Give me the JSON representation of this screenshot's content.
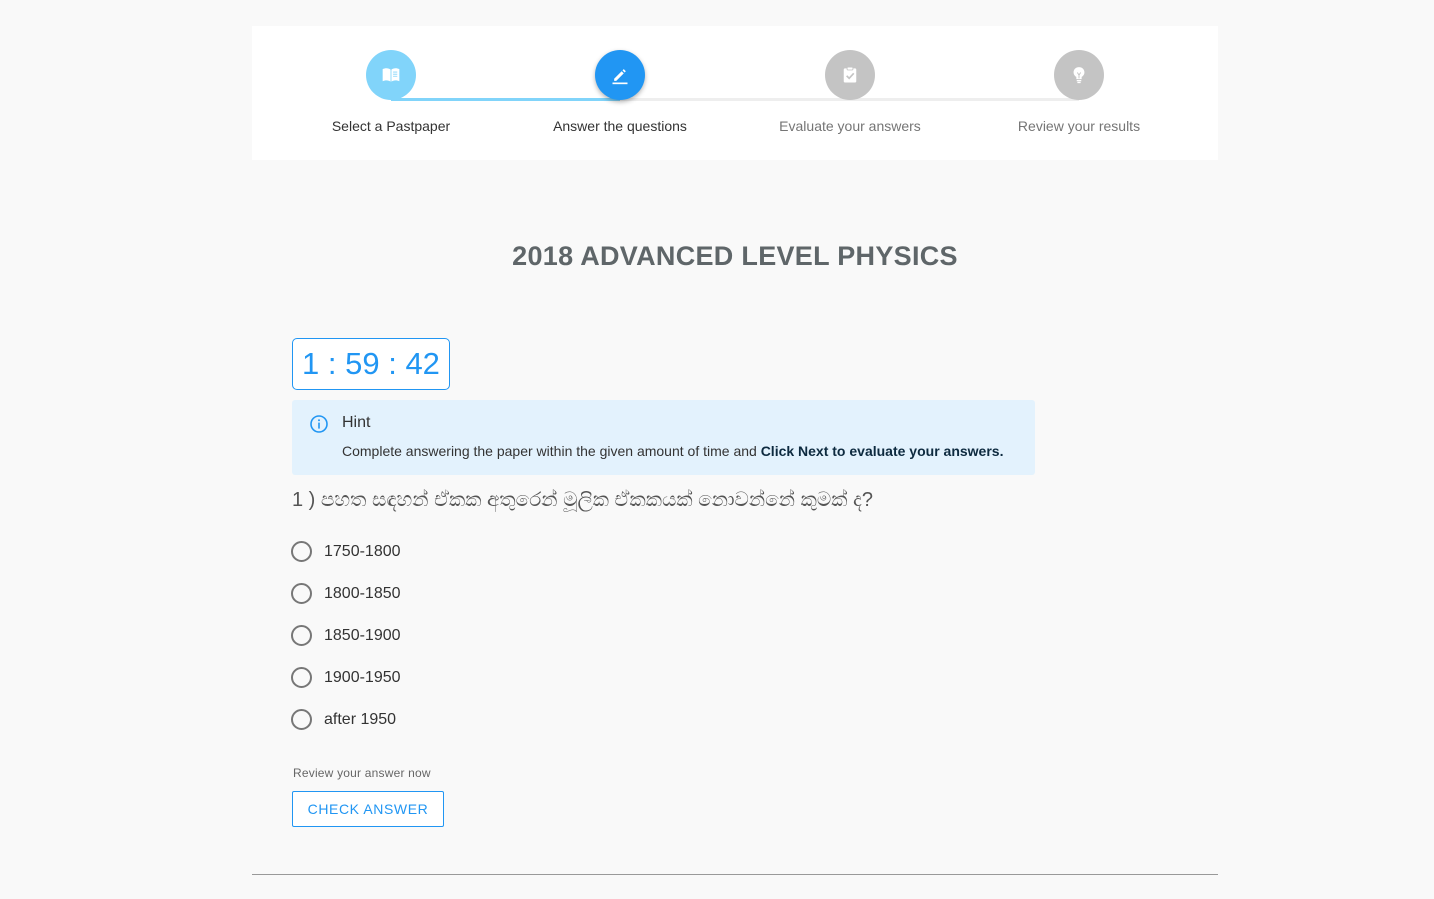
{
  "colors": {
    "accent": "#2196f3",
    "step_done": "#81d4fa",
    "step_pending": "#c4c4c4",
    "hint_bg": "#e3f2fd"
  },
  "stepper": {
    "steps": [
      {
        "label": "Select a Pastpaper",
        "icon": "book-icon",
        "state": "completed"
      },
      {
        "label": "Answer the questions",
        "icon": "pencil-icon",
        "state": "active"
      },
      {
        "label": "Evaluate your answers",
        "icon": "clipboard-check-icon",
        "state": "pending"
      },
      {
        "label": "Review your results",
        "icon": "lightbulb-icon",
        "state": "pending"
      }
    ]
  },
  "paper": {
    "title": "2018 ADVANCED LEVEL PHYSICS"
  },
  "timer": {
    "display": "1 : 59 : 42"
  },
  "hint": {
    "icon": "info-icon",
    "title": "Hint",
    "body_plain": "Complete answering the paper within the given amount of time and ",
    "body_bold": "Click Next to evaluate your answers."
  },
  "question": {
    "text": "1 ) පහත සඳහන් ඒකක අතුරෙන් මූලික ඒකකයක් නොවන්නේ කුමක් ද?",
    "options": [
      {
        "label": "1750-1800",
        "selected": false
      },
      {
        "label": "1800-1850",
        "selected": false
      },
      {
        "label": "1850-1900",
        "selected": false
      },
      {
        "label": "1900-1950",
        "selected": false
      },
      {
        "label": "after 1950",
        "selected": false
      }
    ]
  },
  "review": {
    "note": "Review your answer now",
    "button_label": "CHECK ANSWER"
  }
}
